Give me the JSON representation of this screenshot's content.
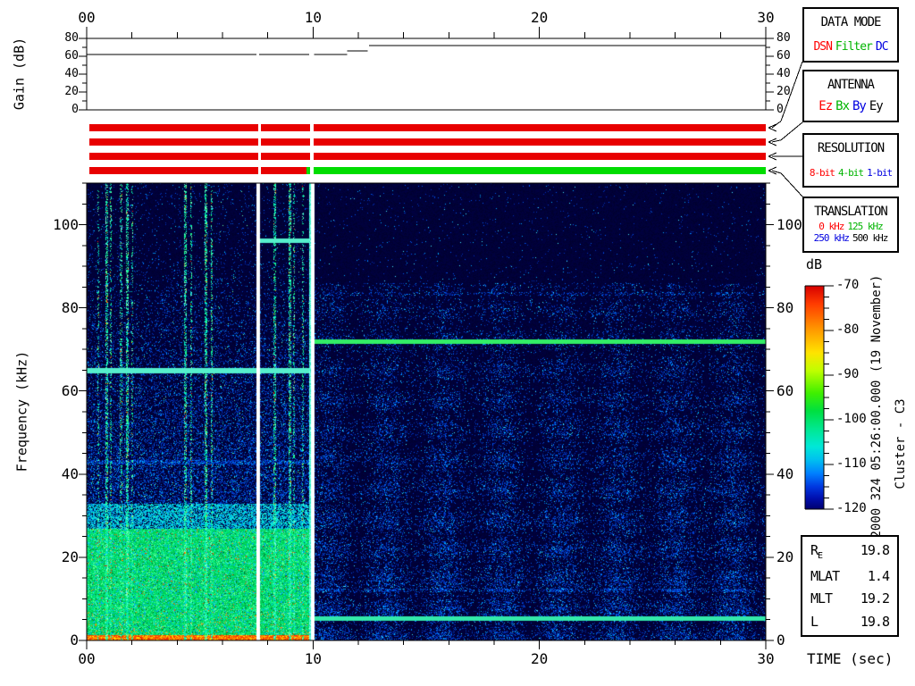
{
  "labels": {
    "time_axis": "TIME (sec)"
  },
  "side_text": {
    "datetime": "2000 324 05:26:00.000 (19 November)",
    "spacecraft": "Cluster - C3"
  },
  "gain_panel": {
    "ylabel": "Gain (dB)",
    "y_range": [
      0,
      80
    ],
    "y_major_step": 20,
    "y_minor_step": 10,
    "y_tick_labels": [
      "0",
      "20",
      "40",
      "60",
      "80"
    ],
    "x_range": [
      0,
      30
    ],
    "x_major_step": 10,
    "x_minor_step": 2,
    "x_major_labels": [
      "00",
      "10",
      "20",
      "30"
    ],
    "trace_color": "#000000",
    "trace_segments": [
      {
        "t0": 0.0,
        "t1": 7.5,
        "db": 62
      },
      {
        "t0": 7.62,
        "t1": 9.83,
        "db": 62
      },
      {
        "t0": 10.04,
        "t1": 11.5,
        "db": 62
      },
      {
        "t0": 11.5,
        "t1": 12.42,
        "db": 66
      },
      {
        "t0": 12.47,
        "t1": 30.0,
        "db": 72
      }
    ]
  },
  "status_bars": {
    "rows": [
      {
        "name": "data-mode-bar",
        "segments": [
          {
            "t0": 0,
            "t1": 7.5,
            "color": "#e80000"
          },
          {
            "t0": 7.62,
            "t1": 9.78,
            "color": "#e80000"
          },
          {
            "t0": 9.93,
            "t1": 30,
            "color": "#e80000"
          }
        ]
      },
      {
        "name": "antenna-bar",
        "segments": [
          {
            "t0": 0,
            "t1": 7.5,
            "color": "#e80000"
          },
          {
            "t0": 7.62,
            "t1": 9.78,
            "color": "#e80000"
          },
          {
            "t0": 9.93,
            "t1": 30,
            "color": "#e80000"
          }
        ]
      },
      {
        "name": "resolution-bar",
        "segments": [
          {
            "t0": 0,
            "t1": 7.5,
            "color": "#e80000"
          },
          {
            "t0": 7.62,
            "t1": 9.78,
            "color": "#e80000"
          },
          {
            "t0": 9.93,
            "t1": 30,
            "color": "#e80000"
          }
        ]
      },
      {
        "name": "translation-bar",
        "segments": [
          {
            "t0": 0,
            "t1": 7.5,
            "color": "#e80000"
          },
          {
            "t0": 7.62,
            "t1": 9.63,
            "color": "#e80000"
          },
          {
            "t0": 9.63,
            "t1": 9.78,
            "color": "#00dd00"
          },
          {
            "t0": 9.93,
            "t1": 30,
            "color": "#00dd00"
          }
        ]
      }
    ]
  },
  "info_boxes": [
    {
      "title": "DATA MODE",
      "font": 13,
      "rows": [
        [
          {
            "label": "DSN",
            "color": "#ff0000"
          },
          {
            "label": "Filter",
            "color": "#00b400"
          },
          {
            "label": "DC",
            "color": "#0000e0"
          }
        ]
      ]
    },
    {
      "title": "ANTENNA",
      "font": 14,
      "rows": [
        [
          {
            "label": "Ez",
            "color": "#ff0000"
          },
          {
            "label": "Bx",
            "color": "#00b400"
          },
          {
            "label": "By",
            "color": "#0000e0"
          },
          {
            "label": "Ey",
            "color": "#000000"
          }
        ]
      ]
    },
    {
      "title": "RESOLUTION",
      "font": 11,
      "rows": [
        [
          {
            "label": "8-bit",
            "color": "#ff0000"
          },
          {
            "label": "4-bit",
            "color": "#00b400"
          },
          {
            "label": "1-bit",
            "color": "#0000e0"
          }
        ]
      ]
    },
    {
      "title": "TRANSLATION",
      "font": 11,
      "rows": [
        [
          {
            "label": "0 kHz",
            "color": "#ff0000"
          },
          {
            "label": "125 kHz",
            "color": "#00b400"
          }
        ],
        [
          {
            "label": "250 kHz",
            "color": "#0000e0"
          },
          {
            "label": "500 kHz",
            "color": "#000000"
          }
        ]
      ]
    }
  ],
  "colorbar": {
    "label": "dB",
    "range": [
      -70,
      -120
    ],
    "major_tick_step": 10,
    "minor_tick_step": 2.5,
    "tick_labels": [
      "-70",
      "-80",
      "-90",
      "-100",
      "-110",
      "-120"
    ],
    "stops": [
      {
        "p": 0.0,
        "c": "#d80000"
      },
      {
        "p": 0.08,
        "c": "#ff3c00"
      },
      {
        "p": 0.2,
        "c": "#ff9c00"
      },
      {
        "p": 0.3,
        "c": "#ffe400"
      },
      {
        "p": 0.38,
        "c": "#c0ff00"
      },
      {
        "p": 0.48,
        "c": "#40f000"
      },
      {
        "p": 0.56,
        "c": "#00e040"
      },
      {
        "p": 0.64,
        "c": "#00e890"
      },
      {
        "p": 0.72,
        "c": "#00e8d8"
      },
      {
        "p": 0.78,
        "c": "#00c0f0"
      },
      {
        "p": 0.84,
        "c": "#0080ff"
      },
      {
        "p": 0.9,
        "c": "#0038e0"
      },
      {
        "p": 0.95,
        "c": "#0010b0"
      },
      {
        "p": 1.0,
        "c": "#000070"
      }
    ]
  },
  "ephemeris": {
    "rows": [
      {
        "label": "R",
        "subscript": "E",
        "value": "19.8"
      },
      {
        "label": "MLAT",
        "subscript": "",
        "value": "1.4"
      },
      {
        "label": "MLT",
        "subscript": "",
        "value": "19.2"
      },
      {
        "label": "L",
        "subscript": "",
        "value": "19.8"
      }
    ]
  },
  "active_modes": {
    "data_mode": "DSN",
    "antenna": "Ez",
    "resolution": "8-bit",
    "translation_timeline": [
      {
        "t0": 0,
        "t1": 9.7,
        "value": "0 kHz"
      },
      {
        "t0": 9.7,
        "t1": 30,
        "value": "125 kHz"
      }
    ]
  },
  "chart_data": {
    "type": "heatmap",
    "title": "Cluster C3 WBD wideband spectrogram",
    "xlabel": "TIME (sec)",
    "ylabel": "Frequency (kHz)",
    "x_range_sec": [
      0,
      30
    ],
    "x_major_step": 10,
    "x_minor_step": 2,
    "x_tick_labels": [
      "00",
      "10",
      "20",
      "30"
    ],
    "y_range_khz": [
      0,
      110
    ],
    "y_major_step": 20,
    "y_minor_step": 5,
    "y_tick_labels": [
      "0",
      "20",
      "40",
      "60",
      "80",
      "100"
    ],
    "intensity_range_db": [
      -120,
      -70
    ],
    "segments": [
      {
        "t0": 0.0,
        "t1": 7.5,
        "type": "left"
      },
      {
        "t0": 7.5,
        "t1": 7.62,
        "type": "gap"
      },
      {
        "t0": 7.62,
        "t1": 9.79,
        "type": "left2"
      },
      {
        "t0": 9.79,
        "t1": 9.88,
        "type": "burst"
      },
      {
        "t0": 9.88,
        "t1": 10.04,
        "type": "gap"
      },
      {
        "t0": 10.04,
        "t1": 30.0,
        "type": "right"
      }
    ],
    "data_gaps_sec": [
      [
        7.5,
        7.62
      ],
      [
        9.88,
        10.04
      ]
    ],
    "spectral_lines": [
      {
        "t0": 0.0,
        "t1": 9.83,
        "khz": 65.0,
        "color": "#55eecc",
        "strength": "bright"
      },
      {
        "t0": 7.62,
        "t1": 9.83,
        "khz": 96.3,
        "color": "#55eecc",
        "strength": "bright"
      },
      {
        "t0": 10.04,
        "t1": 30.0,
        "khz": 72.0,
        "color": "#33ee66",
        "strength": "bright"
      },
      {
        "t0": 10.04,
        "t1": 30.0,
        "khz": 5.4,
        "color": "#33e8aa",
        "strength": "bright"
      },
      {
        "t0": 10.04,
        "t1": 30.0,
        "khz": 12.2,
        "color": "",
        "strength": "faint"
      },
      {
        "t0": 10.04,
        "t1": 30.0,
        "khz": 83.5,
        "color": "",
        "strength": "faint"
      },
      {
        "t0": 0.0,
        "t1": 9.79,
        "khz": 43.0,
        "color": "",
        "strength": "faint"
      }
    ],
    "interference_streaks": [
      {
        "t": 0.5,
        "w": 0.08,
        "s": 0.45
      },
      {
        "t": 0.88,
        "w": 0.12,
        "s": 0.95
      },
      {
        "t": 1.06,
        "w": 0.08,
        "s": 0.6
      },
      {
        "t": 1.5,
        "w": 0.08,
        "s": 0.6
      },
      {
        "t": 1.76,
        "w": 0.12,
        "s": 0.95
      },
      {
        "t": 2.0,
        "w": 0.08,
        "s": 0.5
      },
      {
        "t": 4.35,
        "w": 0.12,
        "s": 0.9
      },
      {
        "t": 4.6,
        "w": 0.08,
        "s": 0.55
      },
      {
        "t": 5.25,
        "w": 0.12,
        "s": 0.95
      },
      {
        "t": 5.5,
        "w": 0.08,
        "s": 0.65
      },
      {
        "t": 8.3,
        "w": 0.12,
        "s": 0.9
      },
      {
        "t": 8.95,
        "w": 0.12,
        "s": 0.9
      },
      {
        "t": 9.15,
        "w": 0.08,
        "s": 0.6
      },
      {
        "t": 9.55,
        "w": 0.08,
        "s": 0.55
      }
    ],
    "regions": {
      "left_segment": "broadband noise, green/intense below ~27 kHz, red-orange edge at 0-1 kHz, blue speckle up to 110 kHz",
      "right_segment": "quieter blue noise below ~86 kHz with ~2.5 s periodic banding, dark above 86 kHz"
    },
    "palette": {
      "background_navy": "#000038",
      "speckle_blues": [
        "#0030b8",
        "#0052e8",
        "#0080ff",
        "#00c0ff",
        "#40eeff"
      ],
      "green_zone": [
        "#00cc55",
        "#00ee77",
        "#55ff99",
        "#00ddaa",
        "#00aaff",
        "#007733"
      ],
      "hot": [
        "#ffcc00",
        "#ff7700",
        "#ff2200"
      ],
      "streak_bright": [
        "#00e8c0",
        "#20ff80",
        "#80ffd0"
      ],
      "bottom_edge": [
        "#ff4400",
        "#ff9900",
        "#ffee00",
        "#cc2200"
      ],
      "gap_white": "#ffffff",
      "burst_cyan": [
        "#40f0d0",
        "#20e0c0",
        "#60ffe0",
        "#a0fff0"
      ]
    }
  }
}
